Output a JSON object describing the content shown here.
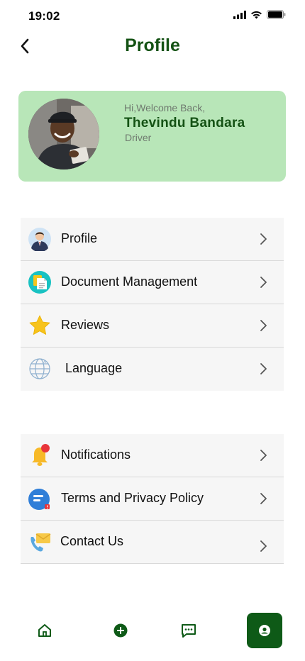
{
  "status_bar": {
    "time": "19:02"
  },
  "header": {
    "title": "Profile"
  },
  "profile_card": {
    "greeting": "Hi,Welcome Back,",
    "name": "Thevindu Bandara",
    "role": "Driver"
  },
  "menu_primary": [
    {
      "label": "Profile",
      "icon": "user-avatar-icon"
    },
    {
      "label": "Document Management",
      "icon": "document-icon"
    },
    {
      "label": "Reviews",
      "icon": "star-icon"
    },
    {
      "label": "Language",
      "icon": "globe-icon"
    }
  ],
  "menu_secondary": [
    {
      "label": "Notifications",
      "icon": "bell-icon"
    },
    {
      "label": "Terms and Privacy Policy",
      "icon": "policy-icon"
    },
    {
      "label": "Contact Us",
      "icon": "phone-mail-icon"
    }
  ],
  "colors": {
    "brand_green": "#145214",
    "card_green": "#b8e6b8",
    "nav_active": "#0e5a17"
  }
}
